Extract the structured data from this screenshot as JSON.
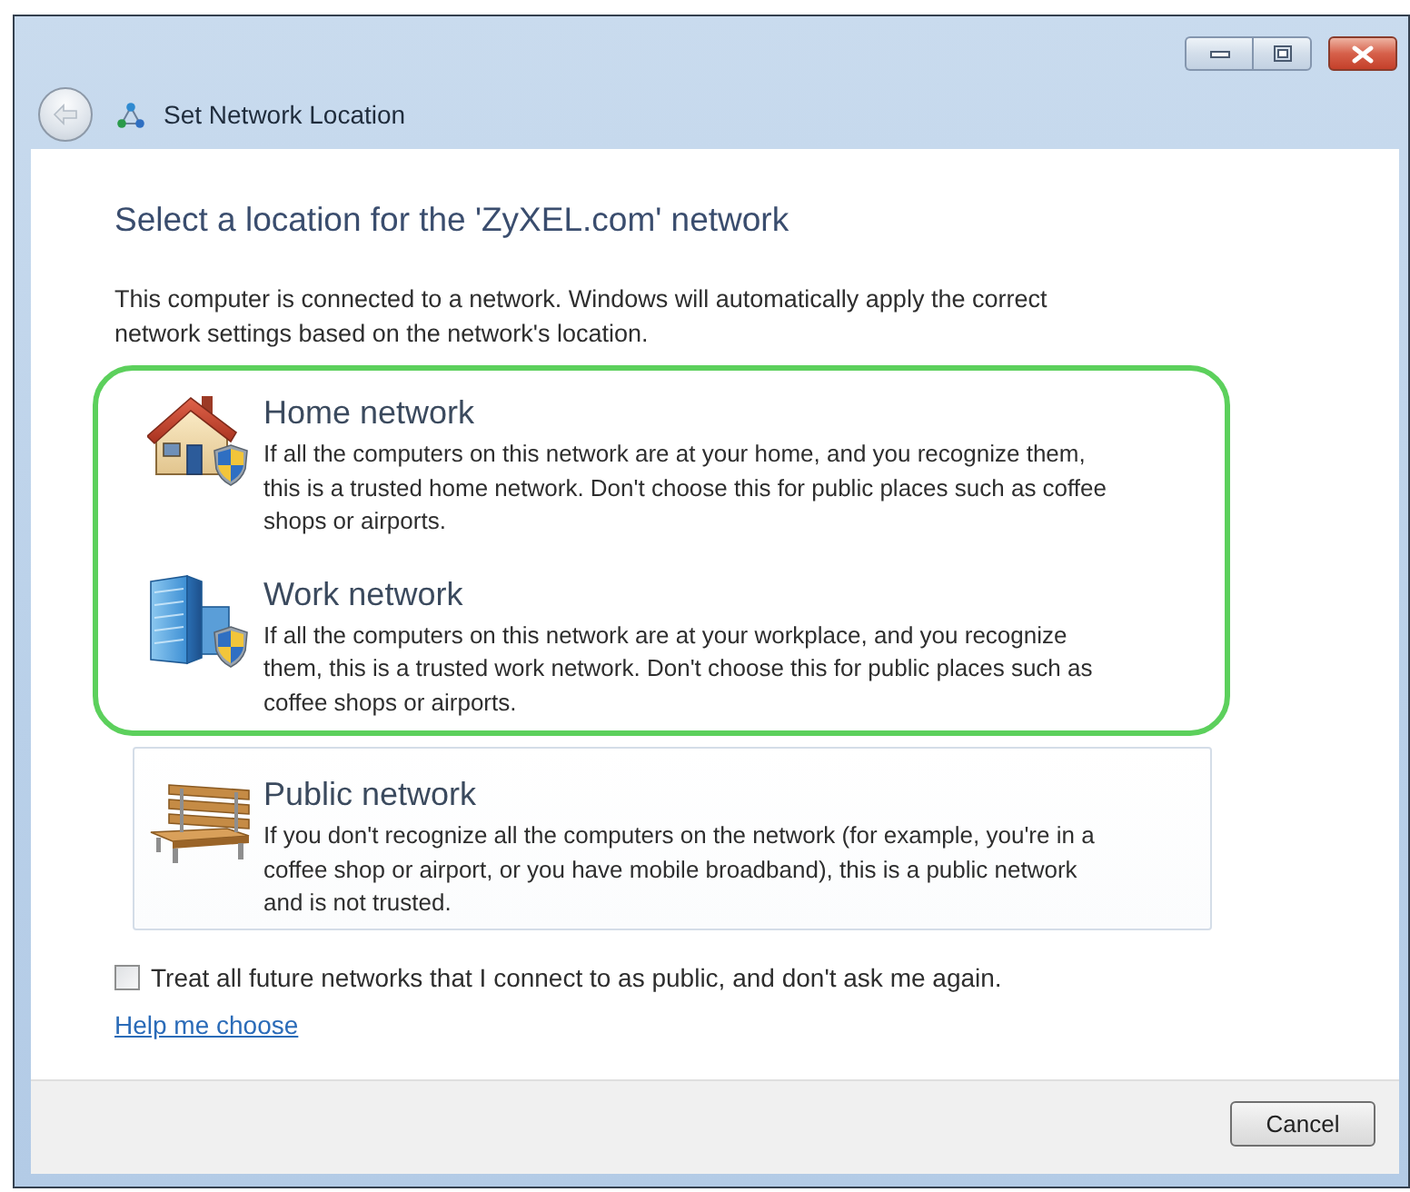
{
  "window": {
    "title": "Set Network Location"
  },
  "heading": "Select a location for the 'ZyXEL.com' network",
  "description": "This computer is connected to a network. Windows will automatically apply the correct network settings based on the network's location.",
  "options": [
    {
      "kind": "home",
      "title": "Home network",
      "description": "If all the computers on this network are at your home, and you recognize them, this is a trusted home network. Don't choose this for public places such as coffee shops or airports.",
      "highlighted": true,
      "hovered": false
    },
    {
      "kind": "work",
      "title": "Work network",
      "description": "If all the computers on this network are at your workplace, and you recognize them, this is a trusted work network. Don't choose this for public places such as coffee shops or airports.",
      "highlighted": true,
      "hovered": false
    },
    {
      "kind": "public",
      "title": "Public network",
      "description": "If you don't recognize all the computers on the network (for example, you're in a coffee shop or airport, or you have mobile broadband), this is a public network and is not trusted.",
      "highlighted": false,
      "hovered": true
    }
  ],
  "future_networks_checkbox": {
    "label": "Treat all future networks that I connect to as public, and don't ask me again.",
    "checked": false
  },
  "help_link": "Help me choose",
  "buttons": [
    {
      "label": "Cancel"
    }
  ]
}
